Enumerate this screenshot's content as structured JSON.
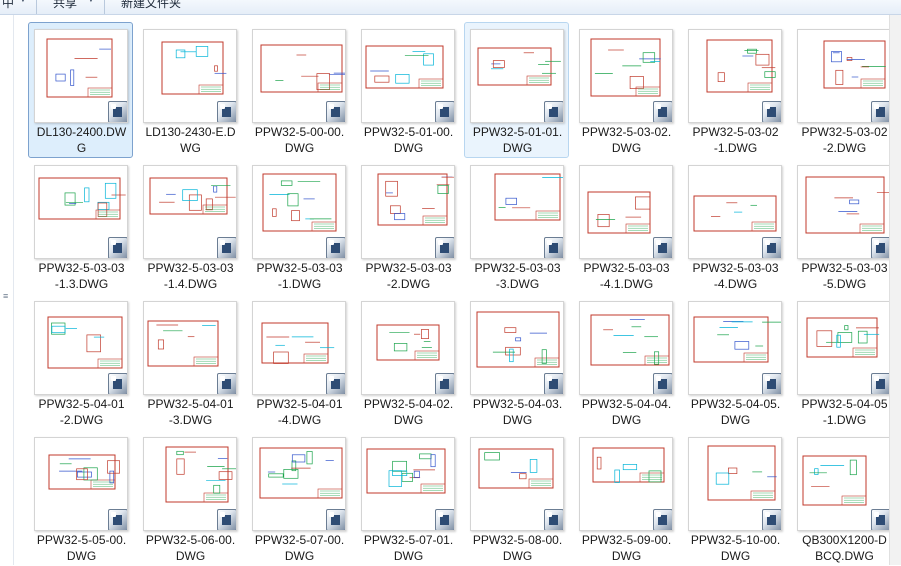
{
  "toolbar": {
    "items": [
      "中",
      "共享",
      "新建文件夹"
    ],
    "arrow": "▼"
  },
  "files": [
    {
      "name": "DL130-2400.DWG",
      "line1": "DL130-2400.DW",
      "line2": "G",
      "state": "selected"
    },
    {
      "name": "LD130-2430-E.DWG",
      "line1": "LD130-2430-E.D",
      "line2": "WG",
      "state": ""
    },
    {
      "name": "PPW32-5-00-00.DWG",
      "line1": "PPW32-5-00-00.",
      "line2": "DWG",
      "state": ""
    },
    {
      "name": "PPW32-5-01-00.DWG",
      "line1": "PPW32-5-01-00.",
      "line2": "DWG",
      "state": ""
    },
    {
      "name": "PPW32-5-01-01.DWG",
      "line1": "PPW32-5-01-01.",
      "line2": "DWG",
      "state": "hover"
    },
    {
      "name": "PPW32-5-03-02.DWG",
      "line1": "PPW32-5-03-02.",
      "line2": "DWG",
      "state": ""
    },
    {
      "name": "PPW32-5-03-02-1.DWG",
      "line1": "PPW32-5-03-02",
      "line2": "-1.DWG",
      "state": ""
    },
    {
      "name": "PPW32-5-03-02-2.DWG",
      "line1": "PPW32-5-03-02",
      "line2": "-2.DWG",
      "state": ""
    },
    {
      "name": "PPW32-5-03-03-1.3.DWG",
      "line1": "PPW32-5-03-03",
      "line2": "-1.3.DWG",
      "state": ""
    },
    {
      "name": "PPW32-5-03-03-1.4.DWG",
      "line1": "PPW32-5-03-03",
      "line2": "-1.4.DWG",
      "state": ""
    },
    {
      "name": "PPW32-5-03-03-1.DWG",
      "line1": "PPW32-5-03-03",
      "line2": "-1.DWG",
      "state": ""
    },
    {
      "name": "PPW32-5-03-03-2.DWG",
      "line1": "PPW32-5-03-03",
      "line2": "-2.DWG",
      "state": ""
    },
    {
      "name": "PPW32-5-03-03-3.DWG",
      "line1": "PPW32-5-03-03",
      "line2": "-3.DWG",
      "state": ""
    },
    {
      "name": "PPW32-5-03-03-4.1.DWG",
      "line1": "PPW32-5-03-03",
      "line2": "-4.1.DWG",
      "state": ""
    },
    {
      "name": "PPW32-5-03-03-4.DWG",
      "line1": "PPW32-5-03-03",
      "line2": "-4.DWG",
      "state": ""
    },
    {
      "name": "PPW32-5-03-03-5.DWG",
      "line1": "PPW32-5-03-03",
      "line2": "-5.DWG",
      "state": ""
    },
    {
      "name": "PPW32-5-04-01-2.DWG",
      "line1": "PPW32-5-04-01",
      "line2": "-2.DWG",
      "state": ""
    },
    {
      "name": "PPW32-5-04-01-3.DWG",
      "line1": "PPW32-5-04-01",
      "line2": "-3.DWG",
      "state": ""
    },
    {
      "name": "PPW32-5-04-01-4.DWG",
      "line1": "PPW32-5-04-01",
      "line2": "-4.DWG",
      "state": ""
    },
    {
      "name": "PPW32-5-04-02.DWG",
      "line1": "PPW32-5-04-02.",
      "line2": "DWG",
      "state": ""
    },
    {
      "name": "PPW32-5-04-03.DWG",
      "line1": "PPW32-5-04-03.",
      "line2": "DWG",
      "state": ""
    },
    {
      "name": "PPW32-5-04-04.DWG",
      "line1": "PPW32-5-04-04.",
      "line2": "DWG",
      "state": ""
    },
    {
      "name": "PPW32-5-04-05.DWG",
      "line1": "PPW32-5-04-05.",
      "line2": "DWG",
      "state": ""
    },
    {
      "name": "PPW32-5-04-05-1.DWG",
      "line1": "PPW32-5-04-05",
      "line2": "-1.DWG",
      "state": ""
    },
    {
      "name": "PPW32-5-05-00.DWG",
      "line1": "PPW32-5-05-00.",
      "line2": "DWG",
      "state": ""
    },
    {
      "name": "PPW32-5-06-00.DWG",
      "line1": "PPW32-5-06-00.",
      "line2": "DWG",
      "state": ""
    },
    {
      "name": "PPW32-5-07-00.DWG",
      "line1": "PPW32-5-07-00.",
      "line2": "DWG",
      "state": ""
    },
    {
      "name": "PPW32-5-07-01.DWG",
      "line1": "PPW32-5-07-01.",
      "line2": "DWG",
      "state": ""
    },
    {
      "name": "PPW32-5-08-00.DWG",
      "line1": "PPW32-5-08-00.",
      "line2": "DWG",
      "state": ""
    },
    {
      "name": "PPW32-5-09-00.DWG",
      "line1": "PPW32-5-09-00.",
      "line2": "DWG",
      "state": ""
    },
    {
      "name": "PPW32-5-10-00.DWG",
      "line1": "PPW32-5-10-00.",
      "line2": "DWG",
      "state": ""
    },
    {
      "name": "QB300X1200-DBCQ.DWG",
      "line1": "QB300X1200-D",
      "line2": "BCQ.DWG",
      "state": ""
    }
  ],
  "colors": {
    "cad_border": "#c0392b",
    "cad_green": "#1aa34a",
    "cad_cyan": "#00b4d8",
    "cad_blue": "#3355cc",
    "selected_bg": "#ddeefc",
    "selected_border": "#7da2ce"
  },
  "icons": {
    "file_type_badge": "autocad-dwg-icon",
    "scroll_up": "chevron-up-icon",
    "scroll_down": "chevron-down-icon"
  }
}
